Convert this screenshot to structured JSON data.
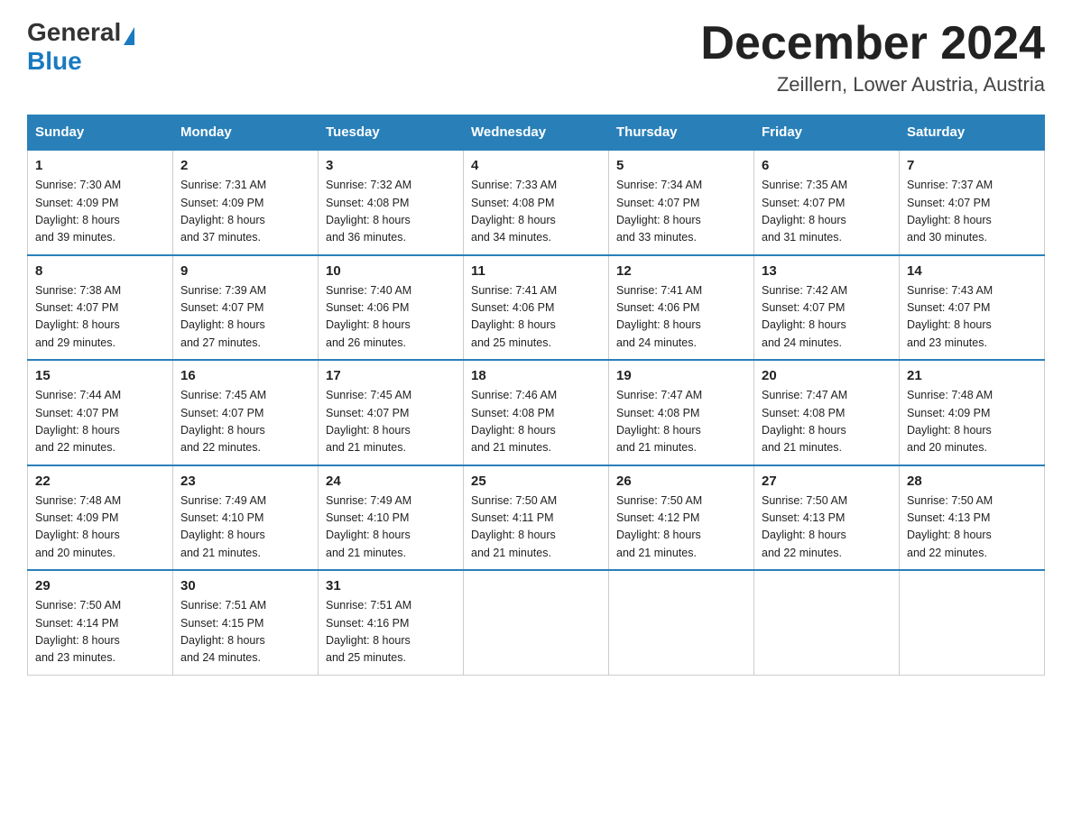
{
  "logo": {
    "general": "General",
    "blue": "Blue"
  },
  "title": "December 2024",
  "location": "Zeillern, Lower Austria, Austria",
  "days_of_week": [
    "Sunday",
    "Monday",
    "Tuesday",
    "Wednesday",
    "Thursday",
    "Friday",
    "Saturday"
  ],
  "weeks": [
    [
      {
        "day": "1",
        "sunrise": "7:30 AM",
        "sunset": "4:09 PM",
        "daylight": "8 hours and 39 minutes."
      },
      {
        "day": "2",
        "sunrise": "7:31 AM",
        "sunset": "4:09 PM",
        "daylight": "8 hours and 37 minutes."
      },
      {
        "day": "3",
        "sunrise": "7:32 AM",
        "sunset": "4:08 PM",
        "daylight": "8 hours and 36 minutes."
      },
      {
        "day": "4",
        "sunrise": "7:33 AM",
        "sunset": "4:08 PM",
        "daylight": "8 hours and 34 minutes."
      },
      {
        "day": "5",
        "sunrise": "7:34 AM",
        "sunset": "4:07 PM",
        "daylight": "8 hours and 33 minutes."
      },
      {
        "day": "6",
        "sunrise": "7:35 AM",
        "sunset": "4:07 PM",
        "daylight": "8 hours and 31 minutes."
      },
      {
        "day": "7",
        "sunrise": "7:37 AM",
        "sunset": "4:07 PM",
        "daylight": "8 hours and 30 minutes."
      }
    ],
    [
      {
        "day": "8",
        "sunrise": "7:38 AM",
        "sunset": "4:07 PM",
        "daylight": "8 hours and 29 minutes."
      },
      {
        "day": "9",
        "sunrise": "7:39 AM",
        "sunset": "4:07 PM",
        "daylight": "8 hours and 27 minutes."
      },
      {
        "day": "10",
        "sunrise": "7:40 AM",
        "sunset": "4:06 PM",
        "daylight": "8 hours and 26 minutes."
      },
      {
        "day": "11",
        "sunrise": "7:41 AM",
        "sunset": "4:06 PM",
        "daylight": "8 hours and 25 minutes."
      },
      {
        "day": "12",
        "sunrise": "7:41 AM",
        "sunset": "4:06 PM",
        "daylight": "8 hours and 24 minutes."
      },
      {
        "day": "13",
        "sunrise": "7:42 AM",
        "sunset": "4:07 PM",
        "daylight": "8 hours and 24 minutes."
      },
      {
        "day": "14",
        "sunrise": "7:43 AM",
        "sunset": "4:07 PM",
        "daylight": "8 hours and 23 minutes."
      }
    ],
    [
      {
        "day": "15",
        "sunrise": "7:44 AM",
        "sunset": "4:07 PM",
        "daylight": "8 hours and 22 minutes."
      },
      {
        "day": "16",
        "sunrise": "7:45 AM",
        "sunset": "4:07 PM",
        "daylight": "8 hours and 22 minutes."
      },
      {
        "day": "17",
        "sunrise": "7:45 AM",
        "sunset": "4:07 PM",
        "daylight": "8 hours and 21 minutes."
      },
      {
        "day": "18",
        "sunrise": "7:46 AM",
        "sunset": "4:08 PM",
        "daylight": "8 hours and 21 minutes."
      },
      {
        "day": "19",
        "sunrise": "7:47 AM",
        "sunset": "4:08 PM",
        "daylight": "8 hours and 21 minutes."
      },
      {
        "day": "20",
        "sunrise": "7:47 AM",
        "sunset": "4:08 PM",
        "daylight": "8 hours and 21 minutes."
      },
      {
        "day": "21",
        "sunrise": "7:48 AM",
        "sunset": "4:09 PM",
        "daylight": "8 hours and 20 minutes."
      }
    ],
    [
      {
        "day": "22",
        "sunrise": "7:48 AM",
        "sunset": "4:09 PM",
        "daylight": "8 hours and 20 minutes."
      },
      {
        "day": "23",
        "sunrise": "7:49 AM",
        "sunset": "4:10 PM",
        "daylight": "8 hours and 21 minutes."
      },
      {
        "day": "24",
        "sunrise": "7:49 AM",
        "sunset": "4:10 PM",
        "daylight": "8 hours and 21 minutes."
      },
      {
        "day": "25",
        "sunrise": "7:50 AM",
        "sunset": "4:11 PM",
        "daylight": "8 hours and 21 minutes."
      },
      {
        "day": "26",
        "sunrise": "7:50 AM",
        "sunset": "4:12 PM",
        "daylight": "8 hours and 21 minutes."
      },
      {
        "day": "27",
        "sunrise": "7:50 AM",
        "sunset": "4:13 PM",
        "daylight": "8 hours and 22 minutes."
      },
      {
        "day": "28",
        "sunrise": "7:50 AM",
        "sunset": "4:13 PM",
        "daylight": "8 hours and 22 minutes."
      }
    ],
    [
      {
        "day": "29",
        "sunrise": "7:50 AM",
        "sunset": "4:14 PM",
        "daylight": "8 hours and 23 minutes."
      },
      {
        "day": "30",
        "sunrise": "7:51 AM",
        "sunset": "4:15 PM",
        "daylight": "8 hours and 24 minutes."
      },
      {
        "day": "31",
        "sunrise": "7:51 AM",
        "sunset": "4:16 PM",
        "daylight": "8 hours and 25 minutes."
      },
      null,
      null,
      null,
      null
    ]
  ],
  "labels": {
    "sunrise": "Sunrise:",
    "sunset": "Sunset:",
    "daylight": "Daylight:"
  },
  "colors": {
    "header_bg": "#2980b9",
    "header_text": "#ffffff",
    "border": "#2980b9"
  }
}
